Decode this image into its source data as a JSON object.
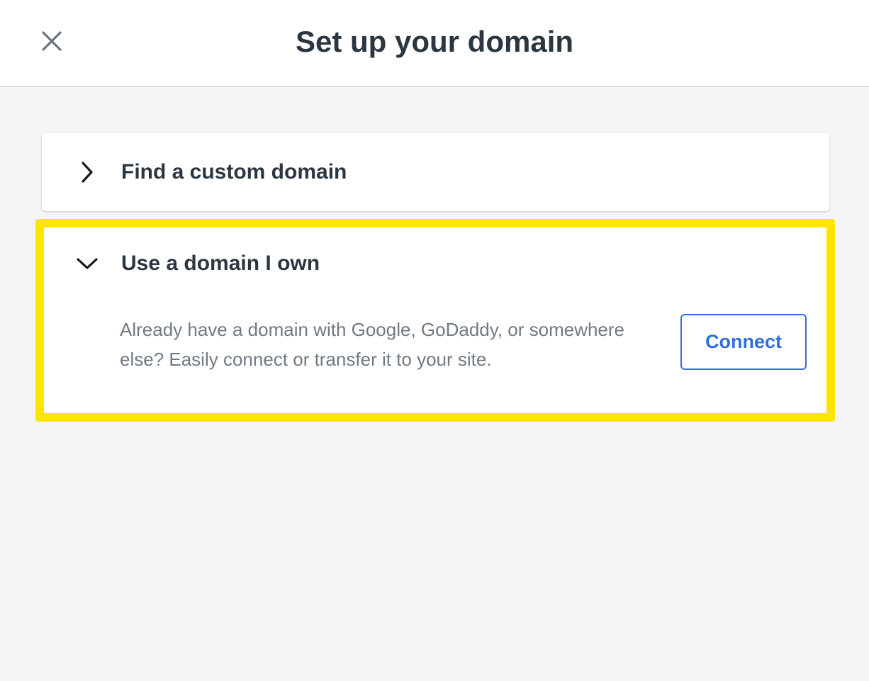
{
  "header": {
    "title": "Set up your domain",
    "close_icon": "close-icon"
  },
  "accordion": [
    {
      "title": "Find a custom domain",
      "expanded": false,
      "icon": "chevron-right-icon"
    },
    {
      "title": "Use a domain I own",
      "expanded": true,
      "icon": "chevron-down-icon",
      "description": "Already have a domain with Google, GoDaddy, or somewhere else? Easily connect or transfer it to your site.",
      "button_label": "Connect"
    }
  ],
  "colors": {
    "accent": "#2f6fdc",
    "highlight": "#ffe600",
    "text_dark": "#2b3640",
    "text_muted": "#707a83",
    "background": "#f3f5f6"
  }
}
